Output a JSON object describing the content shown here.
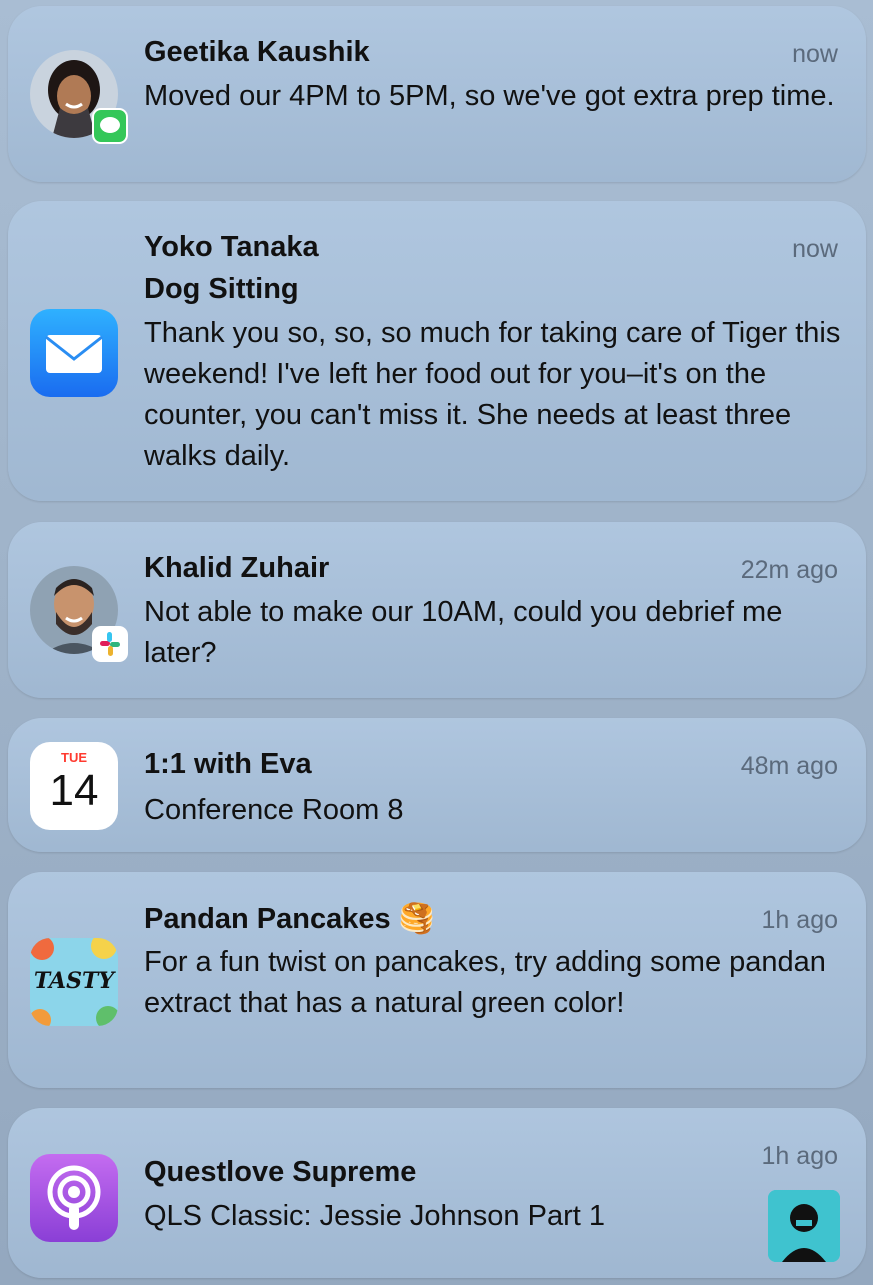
{
  "notifications": [
    {
      "sender": "Geetika Kaushik",
      "time": "now",
      "message": "Moved our 4PM to 5PM, so we've got extra prep time.",
      "app_icon": "messages-icon"
    },
    {
      "sender": "Yoko Tanaka",
      "subject": "Dog Sitting",
      "time": "now",
      "message": "Thank you so, so, so much for taking care of Tiger this weekend! I've left her food out for you–it's on the counter, you can't miss it. She needs at least three walks daily.",
      "app_icon": "mail-icon"
    },
    {
      "sender": "Khalid Zuhair",
      "time": "22m ago",
      "message": "Not able to make our 10AM, could you debrief me later?",
      "app_icon": "slack-icon"
    },
    {
      "sender": "1:1 with Eva",
      "time": "48m ago",
      "message": "Conference Room 8",
      "calendar_day": "TUE",
      "calendar_date": "14",
      "app_icon": "calendar-icon"
    },
    {
      "sender": "Pandan Pancakes",
      "emoji": "🥞",
      "time": "1h ago",
      "message": "For a fun twist on pancakes, try adding some pandan extract that has a natural green color!",
      "app_icon": "tasty-icon",
      "app_icon_text": "TASTY"
    },
    {
      "sender": "Questlove Supreme",
      "time": "1h ago",
      "message": "QLS Classic: Jessie Johnson Part 1",
      "app_icon": "podcasts-icon"
    }
  ],
  "colors": {
    "messages_green": "#34c759",
    "mail_blue": "#1a8cff",
    "podcasts_purple": "#a64fe0",
    "calendar_red": "#ff3b30"
  }
}
